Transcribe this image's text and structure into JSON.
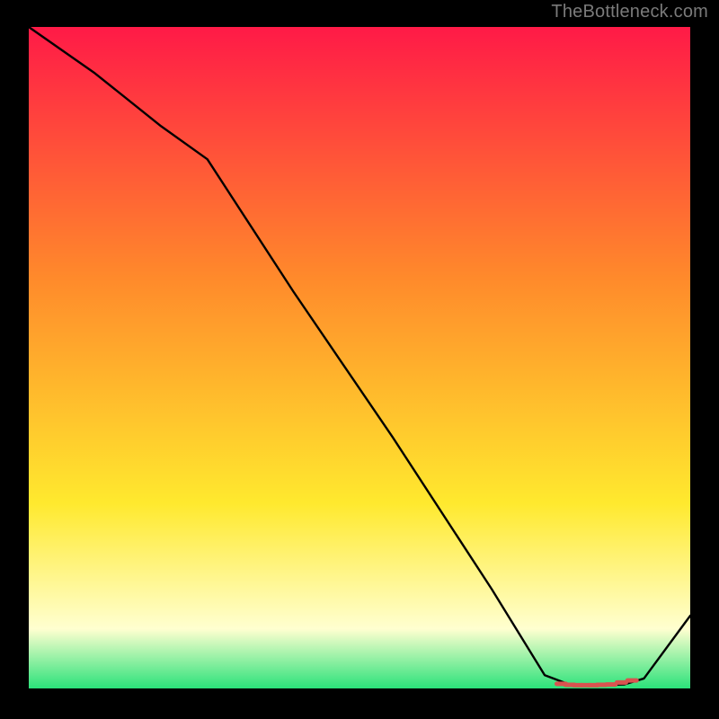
{
  "attribution": "TheBottleneck.com",
  "colors": {
    "gradient_top": "#ff1a47",
    "gradient_mid1": "#ff8a2b",
    "gradient_mid2": "#ffe92e",
    "gradient_pale": "#ffffd0",
    "gradient_bottom": "#2be27a",
    "line": "#000000",
    "marker": "#d9534f",
    "frame": "#000000"
  },
  "chart_data": {
    "type": "line",
    "title": "",
    "xlabel": "",
    "ylabel": "",
    "xlim": [
      0,
      100
    ],
    "ylim": [
      0,
      100
    ],
    "grid": false,
    "legend": false,
    "series": [
      {
        "name": "curve",
        "x": [
          0,
          10,
          20,
          27,
          40,
          55,
          70,
          78,
          82,
          86,
          90,
          93,
          100
        ],
        "y": [
          100,
          93,
          85,
          80,
          60,
          38,
          15,
          2,
          0.5,
          0.5,
          0.6,
          1.5,
          11
        ]
      }
    ],
    "markers": {
      "name": "flat-region",
      "x": [
        80.5,
        81.8,
        83.0,
        84.2,
        85.4,
        86.6,
        88.0,
        89.6,
        91.2
      ],
      "y": [
        0.7,
        0.55,
        0.5,
        0.5,
        0.5,
        0.55,
        0.6,
        0.9,
        1.2
      ]
    }
  }
}
